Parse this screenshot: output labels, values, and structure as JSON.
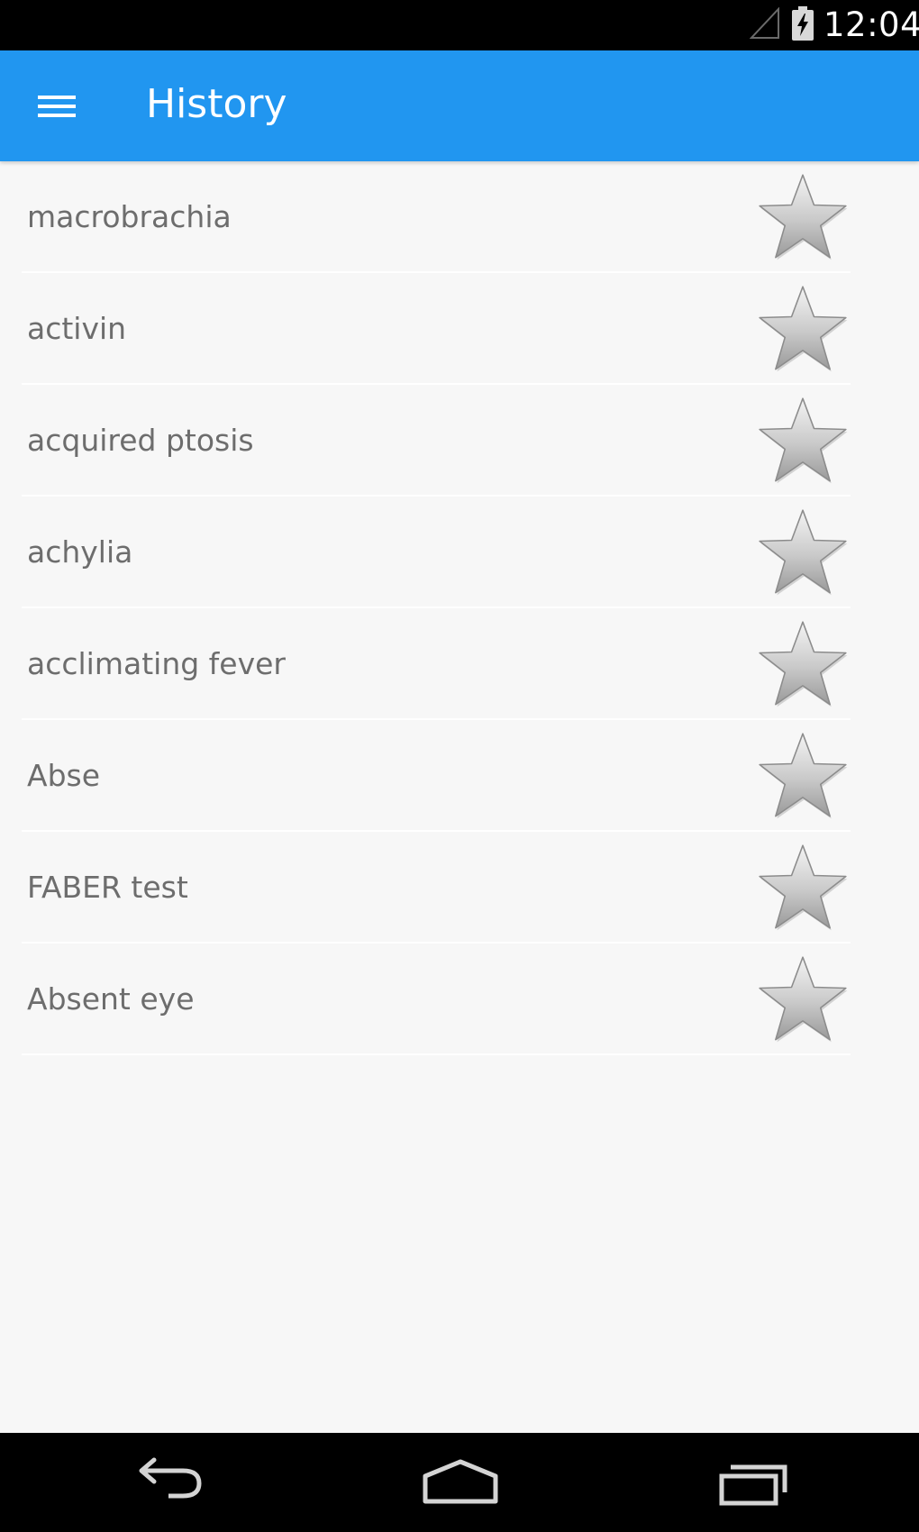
{
  "status_bar": {
    "time": "12:04",
    "signal_icon": "signal-icon",
    "battery_icon": "battery-charging-icon"
  },
  "app_bar": {
    "title": "History",
    "menu_icon": "menu-icon",
    "color": "#2196f0"
  },
  "history": {
    "items": [
      {
        "term": "macrobrachia",
        "favorite": false
      },
      {
        "term": "activin",
        "favorite": false
      },
      {
        "term": "acquired ptosis",
        "favorite": false
      },
      {
        "term": "achylia",
        "favorite": false
      },
      {
        "term": "acclimating fever",
        "favorite": false
      },
      {
        "term": "Abse",
        "favorite": false
      },
      {
        "term": "FABER test",
        "favorite": false
      },
      {
        "term": "Absent eye",
        "favorite": false
      }
    ],
    "star_icon": "star-icon"
  },
  "nav_bar": {
    "back_icon": "back-icon",
    "home_icon": "home-icon",
    "recents_icon": "recents-icon"
  }
}
